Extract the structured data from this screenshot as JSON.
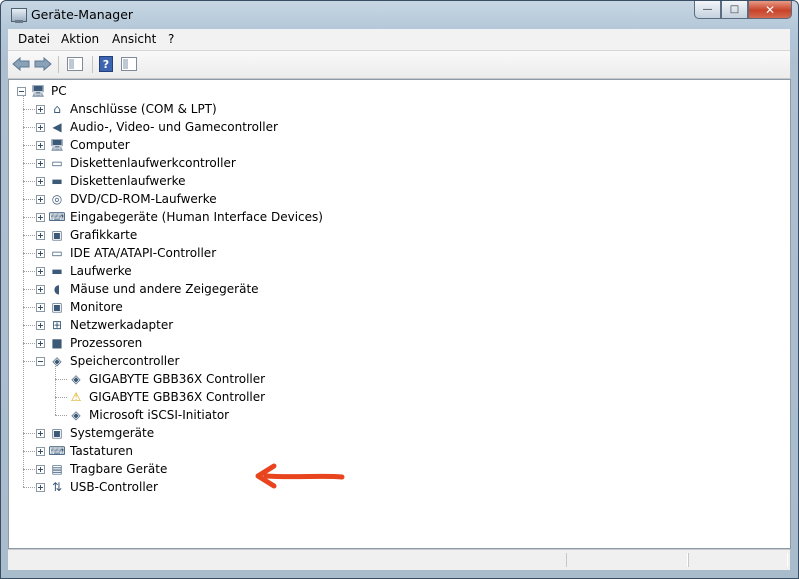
{
  "window": {
    "title": "Geräte-Manager",
    "minimize_glyph": "—",
    "maximize_glyph": "□",
    "close_glyph": "✕"
  },
  "menu": [
    "Datei",
    "Aktion",
    "Ansicht",
    "?"
  ],
  "toolbar": {
    "back_icon": "back-arrow-icon",
    "forward_icon": "forward-arrow-icon",
    "console_tree_icon": "console-tree-icon",
    "help_label": "?",
    "view_pane_icon": "view-pane-icon"
  },
  "tree": {
    "root": {
      "label": "PC",
      "icon": "computer-icon",
      "expanded": true
    },
    "categories": [
      {
        "label": "Anschlüsse (COM & LPT)",
        "icon": "port-icon"
      },
      {
        "label": "Audio-, Video- und Gamecontroller",
        "icon": "speaker-icon"
      },
      {
        "label": "Computer",
        "icon": "computer-icon"
      },
      {
        "label": "Diskettenlaufwerkcontroller",
        "icon": "controller-icon"
      },
      {
        "label": "Diskettenlaufwerke",
        "icon": "floppy-drive-icon"
      },
      {
        "label": "DVD/CD-ROM-Laufwerke",
        "icon": "cdrom-icon"
      },
      {
        "label": "Eingabegeräte (Human Interface Devices)",
        "icon": "hid-icon"
      },
      {
        "label": "Grafikkarte",
        "icon": "display-adapter-icon"
      },
      {
        "label": "IDE ATA/ATAPI-Controller",
        "icon": "ide-controller-icon"
      },
      {
        "label": "Laufwerke",
        "icon": "disk-drive-icon"
      },
      {
        "label": "Mäuse und andere Zeigegeräte",
        "icon": "mouse-icon"
      },
      {
        "label": "Monitore",
        "icon": "monitor-icon"
      },
      {
        "label": "Netzwerkadapter",
        "icon": "network-adapter-icon"
      },
      {
        "label": "Prozessoren",
        "icon": "processor-icon"
      },
      {
        "label": "Speichercontroller",
        "icon": "storage-controller-icon",
        "expanded": true,
        "children": [
          {
            "label": "GIGABYTE GBB36X Controller",
            "icon": "storage-controller-icon"
          },
          {
            "label": "GIGABYTE GBB36X Controller",
            "icon": "warning-icon"
          },
          {
            "label": "Microsoft iSCSI-Initiator",
            "icon": "storage-controller-icon"
          }
        ]
      },
      {
        "label": "Systemgeräte",
        "icon": "system-device-icon"
      },
      {
        "label": "Tastaturen",
        "icon": "keyboard-icon"
      },
      {
        "label": "Tragbare Geräte",
        "icon": "portable-device-icon"
      },
      {
        "label": "USB-Controller",
        "icon": "usb-icon"
      }
    ]
  },
  "annotation": {
    "icon": "red-arrow-annotation",
    "color": "#e8451e"
  },
  "colors": {
    "titlebar": "#b8cad9",
    "tree_background": "#ffffff",
    "close_button": "#c8432a"
  }
}
